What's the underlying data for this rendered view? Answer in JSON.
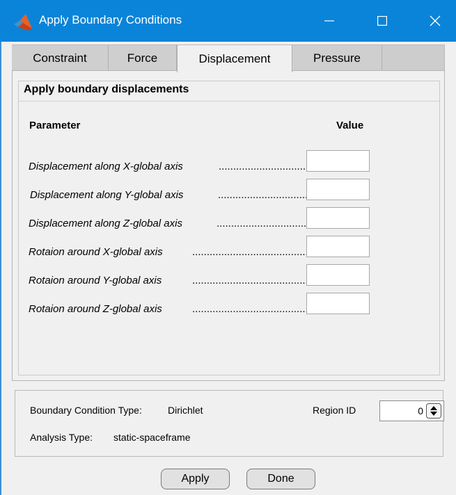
{
  "window": {
    "title": "Apply Boundary Conditions"
  },
  "tabs": [
    {
      "label": "Constraint"
    },
    {
      "label": "Force"
    },
    {
      "label": "Displacement"
    },
    {
      "label": "Pressure"
    }
  ],
  "panel": {
    "title": "Apply boundary displacements",
    "header_param": "Parameter",
    "header_value": "Value",
    "rows": [
      {
        "label": "Displacement along X-global axis",
        "dots": "...............................",
        "value": ""
      },
      {
        "label": "Displacement along Y-global axis",
        "dots": "...............................",
        "value": ""
      },
      {
        "label": "Displacement along Z-global axis",
        "dots": "...............................",
        "value": ""
      },
      {
        "label": "Rotaion around X-global axis",
        "dots": "..........................................",
        "value": ""
      },
      {
        "label": "Rotaion around Y-global axis",
        "dots": "..........................................",
        "value": ""
      },
      {
        "label": "Rotaion around Z-global axis",
        "dots": "..........................................",
        "value": ""
      }
    ]
  },
  "info": {
    "bc_type_label": "Boundary Condition Type:",
    "bc_type_value": "Dirichlet",
    "analysis_label": "Analysis Type:",
    "analysis_value": "static-spaceframe",
    "region_label": "Region ID",
    "region_value": "0"
  },
  "buttons": {
    "apply": "Apply",
    "done": "Done"
  },
  "colors": {
    "titlebar": "#0a84d8",
    "tab_inactive": "#cfcfcf",
    "background": "#f0f0f0"
  },
  "icons": {
    "app": "matlab-logo-icon",
    "minimize": "minimize-icon",
    "maximize": "maximize-icon",
    "close": "close-icon"
  }
}
